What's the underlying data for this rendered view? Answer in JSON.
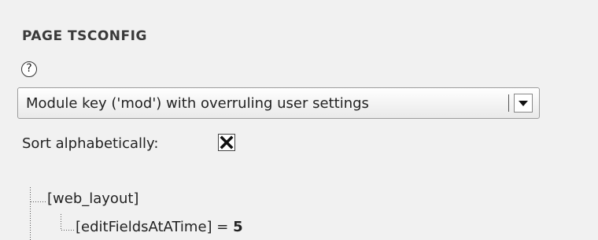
{
  "section": {
    "title": "PAGE TSCONFIG"
  },
  "help": {
    "glyph": "?"
  },
  "module_select": {
    "selected": "Module key ('mod') with overruling user settings"
  },
  "sort": {
    "label": "Sort alphabetically:",
    "checked": true
  },
  "tree": {
    "nodes": [
      {
        "key": "[web_layout]"
      },
      {
        "key": "[editFieldsAtATime]",
        "operator": " = ",
        "value": "5"
      }
    ]
  }
}
